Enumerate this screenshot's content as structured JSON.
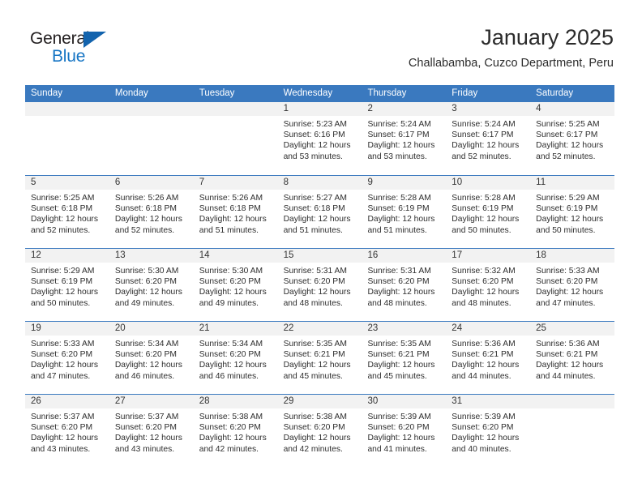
{
  "brand": {
    "name_part1": "General",
    "name_part2": "Blue",
    "triangle_icon": "triangle-icon",
    "color_dark": "#231f20",
    "color_blue": "#1675c4"
  },
  "header": {
    "title": "January 2025",
    "subtitle": "Challabamba, Cuzco Department, Peru"
  },
  "theme": {
    "header_blue": "#3a79bf",
    "day_band_gray": "#f2f2f2",
    "text_color": "#2d2d2d"
  },
  "weekdays": [
    "Sunday",
    "Monday",
    "Tuesday",
    "Wednesday",
    "Thursday",
    "Friday",
    "Saturday"
  ],
  "weeks": [
    [
      {
        "day": "",
        "info": ""
      },
      {
        "day": "",
        "info": ""
      },
      {
        "day": "",
        "info": ""
      },
      {
        "day": "1",
        "info": "Sunrise: 5:23 AM\nSunset: 6:16 PM\nDaylight: 12 hours\nand 53 minutes."
      },
      {
        "day": "2",
        "info": "Sunrise: 5:24 AM\nSunset: 6:17 PM\nDaylight: 12 hours\nand 53 minutes."
      },
      {
        "day": "3",
        "info": "Sunrise: 5:24 AM\nSunset: 6:17 PM\nDaylight: 12 hours\nand 52 minutes."
      },
      {
        "day": "4",
        "info": "Sunrise: 5:25 AM\nSunset: 6:17 PM\nDaylight: 12 hours\nand 52 minutes."
      }
    ],
    [
      {
        "day": "5",
        "info": "Sunrise: 5:25 AM\nSunset: 6:18 PM\nDaylight: 12 hours\nand 52 minutes."
      },
      {
        "day": "6",
        "info": "Sunrise: 5:26 AM\nSunset: 6:18 PM\nDaylight: 12 hours\nand 52 minutes."
      },
      {
        "day": "7",
        "info": "Sunrise: 5:26 AM\nSunset: 6:18 PM\nDaylight: 12 hours\nand 51 minutes."
      },
      {
        "day": "8",
        "info": "Sunrise: 5:27 AM\nSunset: 6:18 PM\nDaylight: 12 hours\nand 51 minutes."
      },
      {
        "day": "9",
        "info": "Sunrise: 5:28 AM\nSunset: 6:19 PM\nDaylight: 12 hours\nand 51 minutes."
      },
      {
        "day": "10",
        "info": "Sunrise: 5:28 AM\nSunset: 6:19 PM\nDaylight: 12 hours\nand 50 minutes."
      },
      {
        "day": "11",
        "info": "Sunrise: 5:29 AM\nSunset: 6:19 PM\nDaylight: 12 hours\nand 50 minutes."
      }
    ],
    [
      {
        "day": "12",
        "info": "Sunrise: 5:29 AM\nSunset: 6:19 PM\nDaylight: 12 hours\nand 50 minutes."
      },
      {
        "day": "13",
        "info": "Sunrise: 5:30 AM\nSunset: 6:20 PM\nDaylight: 12 hours\nand 49 minutes."
      },
      {
        "day": "14",
        "info": "Sunrise: 5:30 AM\nSunset: 6:20 PM\nDaylight: 12 hours\nand 49 minutes."
      },
      {
        "day": "15",
        "info": "Sunrise: 5:31 AM\nSunset: 6:20 PM\nDaylight: 12 hours\nand 48 minutes."
      },
      {
        "day": "16",
        "info": "Sunrise: 5:31 AM\nSunset: 6:20 PM\nDaylight: 12 hours\nand 48 minutes."
      },
      {
        "day": "17",
        "info": "Sunrise: 5:32 AM\nSunset: 6:20 PM\nDaylight: 12 hours\nand 48 minutes."
      },
      {
        "day": "18",
        "info": "Sunrise: 5:33 AM\nSunset: 6:20 PM\nDaylight: 12 hours\nand 47 minutes."
      }
    ],
    [
      {
        "day": "19",
        "info": "Sunrise: 5:33 AM\nSunset: 6:20 PM\nDaylight: 12 hours\nand 47 minutes."
      },
      {
        "day": "20",
        "info": "Sunrise: 5:34 AM\nSunset: 6:20 PM\nDaylight: 12 hours\nand 46 minutes."
      },
      {
        "day": "21",
        "info": "Sunrise: 5:34 AM\nSunset: 6:20 PM\nDaylight: 12 hours\nand 46 minutes."
      },
      {
        "day": "22",
        "info": "Sunrise: 5:35 AM\nSunset: 6:21 PM\nDaylight: 12 hours\nand 45 minutes."
      },
      {
        "day": "23",
        "info": "Sunrise: 5:35 AM\nSunset: 6:21 PM\nDaylight: 12 hours\nand 45 minutes."
      },
      {
        "day": "24",
        "info": "Sunrise: 5:36 AM\nSunset: 6:21 PM\nDaylight: 12 hours\nand 44 minutes."
      },
      {
        "day": "25",
        "info": "Sunrise: 5:36 AM\nSunset: 6:21 PM\nDaylight: 12 hours\nand 44 minutes."
      }
    ],
    [
      {
        "day": "26",
        "info": "Sunrise: 5:37 AM\nSunset: 6:20 PM\nDaylight: 12 hours\nand 43 minutes."
      },
      {
        "day": "27",
        "info": "Sunrise: 5:37 AM\nSunset: 6:20 PM\nDaylight: 12 hours\nand 43 minutes."
      },
      {
        "day": "28",
        "info": "Sunrise: 5:38 AM\nSunset: 6:20 PM\nDaylight: 12 hours\nand 42 minutes."
      },
      {
        "day": "29",
        "info": "Sunrise: 5:38 AM\nSunset: 6:20 PM\nDaylight: 12 hours\nand 42 minutes."
      },
      {
        "day": "30",
        "info": "Sunrise: 5:39 AM\nSunset: 6:20 PM\nDaylight: 12 hours\nand 41 minutes."
      },
      {
        "day": "31",
        "info": "Sunrise: 5:39 AM\nSunset: 6:20 PM\nDaylight: 12 hours\nand 40 minutes."
      },
      {
        "day": "",
        "info": ""
      }
    ]
  ]
}
